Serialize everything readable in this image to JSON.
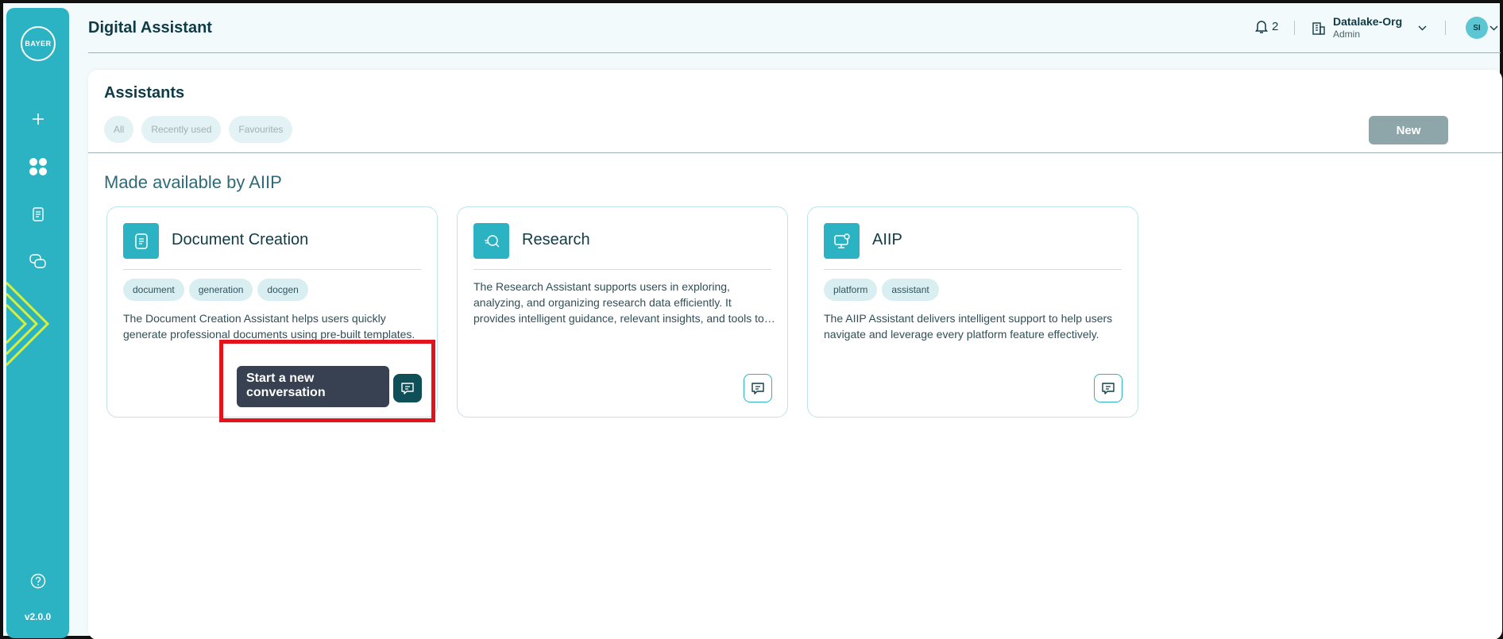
{
  "app": {
    "title": "Digital Assistant",
    "logo_text": "BAYER",
    "version": "v2.0.0"
  },
  "header": {
    "notification_count": "2",
    "org_name": "Datalake-Org",
    "org_role": "Admin",
    "avatar_initials": "SI"
  },
  "panel": {
    "title": "Assistants",
    "filters": [
      "All",
      "Recently used",
      "Favourites"
    ],
    "new_button": "New",
    "section_title": "Made available by AIIP"
  },
  "cards": [
    {
      "title": "Document Creation",
      "icon": "document-icon",
      "tags": [
        "document",
        "generation",
        "docgen"
      ],
      "description": "The Document Creation Assistant helps users quickly generate professional documents using pre-built templates."
    },
    {
      "title": "Research",
      "icon": "search-icon",
      "tags": [],
      "description": "The Research Assistant supports users in exploring, analyzing, and organizing research data efficiently. It provides intelligent guidance, relevant insights, and tools to streamline research workflows."
    },
    {
      "title": "AIIP",
      "icon": "monitor-gear-icon",
      "tags": [
        "platform",
        "assistant"
      ],
      "description": "The AIIP Assistant delivers intelligent support to help users navigate and leverage every platform feature effectively."
    }
  ],
  "tooltip": {
    "text": "Start a new conversation"
  },
  "colors": {
    "brand": "#2bb3c3",
    "dark": "#0f3b46",
    "highlight": "#e3131b"
  }
}
